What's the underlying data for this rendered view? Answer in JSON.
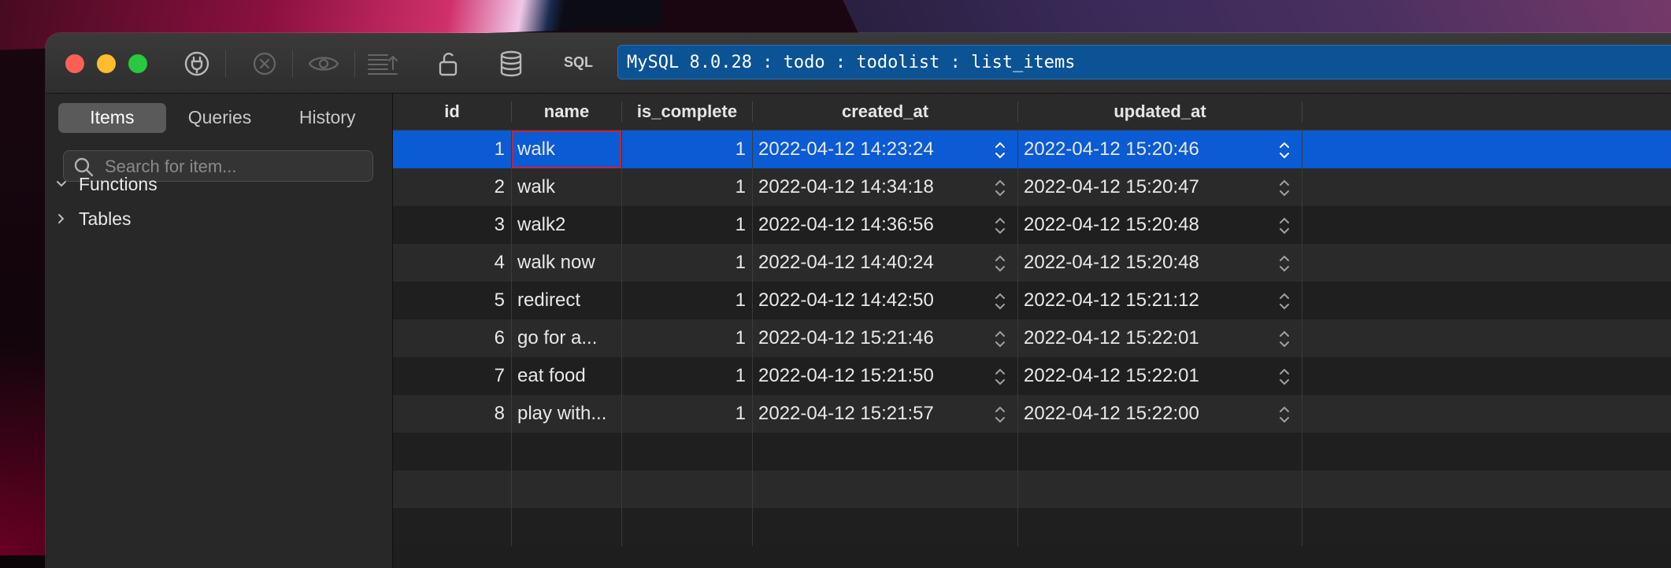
{
  "toolbar": {
    "sql_label": "SQL",
    "connection": "MySQL 8.0.28 : todo : todolist : list_items"
  },
  "sidebar": {
    "tabs": [
      "Items",
      "Queries",
      "History"
    ],
    "active_tab": "Items",
    "search_placeholder": "Search for item...",
    "tree": [
      {
        "label": "Functions",
        "expanded": true
      },
      {
        "label": "Tables",
        "expanded": false
      }
    ]
  },
  "table": {
    "columns": [
      "id",
      "name",
      "is_complete",
      "created_at",
      "updated_at"
    ],
    "selected_row": 0,
    "rows": [
      {
        "id": "1",
        "name": "walk",
        "is_complete": "1",
        "created_at": "2022-04-12 14:23:24",
        "updated_at": "2022-04-12 15:20:46"
      },
      {
        "id": "2",
        "name": "walk",
        "is_complete": "1",
        "created_at": "2022-04-12 14:34:18",
        "updated_at": "2022-04-12 15:20:47"
      },
      {
        "id": "3",
        "name": "walk2",
        "is_complete": "1",
        "created_at": "2022-04-12 14:36:56",
        "updated_at": "2022-04-12 15:20:48"
      },
      {
        "id": "4",
        "name": "walk now",
        "is_complete": "1",
        "created_at": "2022-04-12 14:40:24",
        "updated_at": "2022-04-12 15:20:48"
      },
      {
        "id": "5",
        "name": "redirect",
        "is_complete": "1",
        "created_at": "2022-04-12 14:42:50",
        "updated_at": "2022-04-12 15:21:12"
      },
      {
        "id": "6",
        "name": "go for a...",
        "is_complete": "1",
        "created_at": "2022-04-12 15:21:46",
        "updated_at": "2022-04-12 15:22:01"
      },
      {
        "id": "7",
        "name": "eat food",
        "is_complete": "1",
        "created_at": "2022-04-12 15:21:50",
        "updated_at": "2022-04-12 15:22:01"
      },
      {
        "id": "8",
        "name": "play with...",
        "is_complete": "1",
        "created_at": "2022-04-12 15:21:57",
        "updated_at": "2022-04-12 15:22:00"
      }
    ]
  },
  "colors": {
    "selection": "#0a5bd4",
    "edit_outline": "#c0263c",
    "connection_bar": "#0b5394"
  }
}
